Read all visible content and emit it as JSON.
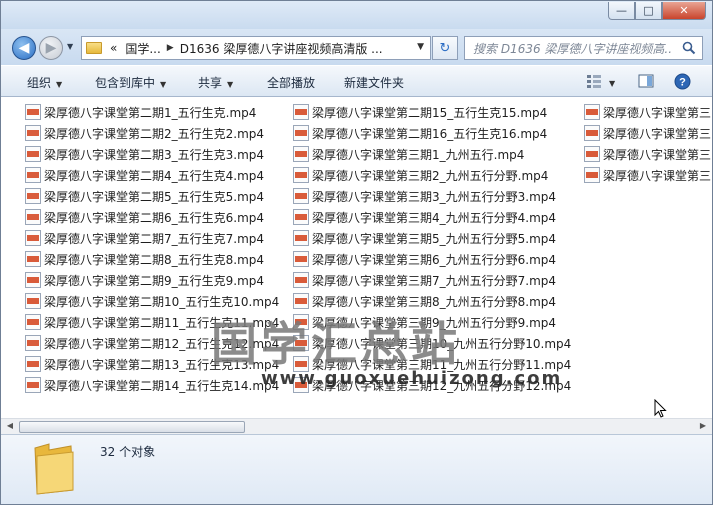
{
  "window": {
    "title": "",
    "caption_buttons": {
      "minimize": "—",
      "maximize": "□",
      "close": "✕"
    }
  },
  "nav": {
    "back_icon": "back-arrow-icon",
    "forward_icon": "forward-arrow-icon",
    "address": {
      "prefix": "«",
      "segments": [
        "国学...",
        "D1636 梁厚德八字讲座视频高清版 ..."
      ]
    },
    "refresh_icon": "refresh-icon",
    "search_placeholder": "搜索 D1636 梁厚德八字讲座视频高..."
  },
  "toolbar": {
    "organize": "组织",
    "include_in_library": "包含到库中",
    "share": "共享",
    "play_all": "全部播放",
    "new_folder": "新建文件夹"
  },
  "files": {
    "column1": [
      "梁厚德八字课堂第二期1_五行生克.mp4",
      "梁厚德八字课堂第二期2_五行生克2.mp4",
      "梁厚德八字课堂第二期3_五行生克3.mp4",
      "梁厚德八字课堂第二期4_五行生克4.mp4",
      "梁厚德八字课堂第二期5_五行生克5.mp4",
      "梁厚德八字课堂第二期6_五行生克6.mp4",
      "梁厚德八字课堂第二期7_五行生克7.mp4",
      "梁厚德八字课堂第二期8_五行生克8.mp4",
      "梁厚德八字课堂第二期9_五行生克9.mp4",
      "梁厚德八字课堂第二期10_五行生克10.mp4",
      "梁厚德八字课堂第二期11_五行生克11.mp4",
      "梁厚德八字课堂第二期12_五行生克12.mp4",
      "梁厚德八字课堂第二期13_五行生克13.mp4",
      "梁厚德八字课堂第二期14_五行生克14.mp4"
    ],
    "column2": [
      "梁厚德八字课堂第二期15_五行生克15.mp4",
      "梁厚德八字课堂第二期16_五行生克16.mp4",
      "梁厚德八字课堂第三期1_九州五行.mp4",
      "梁厚德八字课堂第三期2_九州五行分野.mp4",
      "梁厚德八字课堂第三期3_九州五行分野3.mp4",
      "梁厚德八字课堂第三期4_九州五行分野4.mp4",
      "梁厚德八字课堂第三期5_九州五行分野5.mp4",
      "梁厚德八字课堂第三期6_九州五行分野6.mp4",
      "梁厚德八字课堂第三期7_九州五行分野7.mp4",
      "梁厚德八字课堂第三期8_九州五行分野8.mp4",
      "梁厚德八字课堂第三期9_九州五行分野9.mp4",
      "梁厚德八字课堂第三期10_九州五行分野10.mp4",
      "梁厚德八字课堂第三期11_九州五行分野11.mp4",
      "梁厚德八字课堂第三期12_九州五行分野12.mp4"
    ],
    "column3": [
      "梁厚德八字课堂第三",
      "梁厚德八字课堂第三",
      "梁厚德八字课堂第三",
      "梁厚德八字课堂第三"
    ]
  },
  "watermark": {
    "text": "国学汇总站",
    "url": "www.guoxuehuizong.com"
  },
  "status": {
    "count": "32 个对象"
  },
  "colors": {
    "nav_bg": "#c8daef",
    "toolbar_bg": "#dce7f3",
    "mp4_icon": "#d95b3a"
  }
}
